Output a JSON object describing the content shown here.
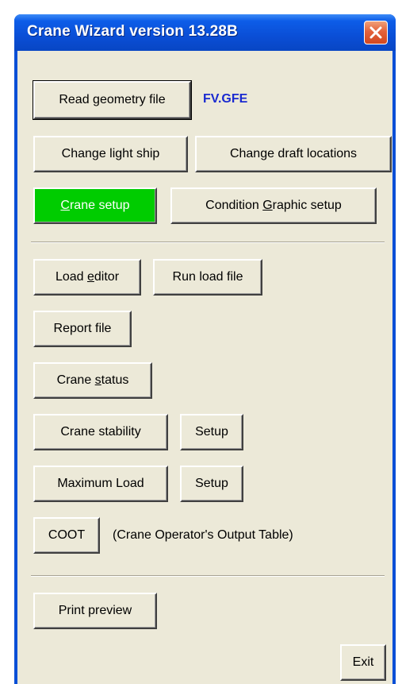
{
  "window": {
    "title": "Crane Wizard version 13.28B"
  },
  "geometry": {
    "read_button": "Read geometry file",
    "filename": "FV.GFE"
  },
  "buttons": {
    "change_light_ship": "Change light ship",
    "change_draft_locations": "Change draft locations",
    "crane_setup": {
      "accel": "C",
      "rest": "rane setup"
    },
    "condition_graphic_setup": {
      "pre": "Condition ",
      "accel": "G",
      "post": "raphic setup"
    },
    "load_editor": {
      "pre": "Load ",
      "accel": "e",
      "post": "ditor"
    },
    "run_load_file": "Run load file",
    "report_file": "Report file",
    "crane_status": {
      "pre": "Crane ",
      "accel": "s",
      "post": "tatus"
    },
    "crane_stability": "Crane stability",
    "crane_stability_setup": "Setup",
    "maximum_load": "Maximum Load",
    "maximum_load_setup": "Setup",
    "coot": "COOT",
    "coot_description": "(Crane Operator's Output Table)",
    "print_preview": "Print preview",
    "exit": "Exit"
  },
  "colors": {
    "crane_setup_active": "#00cc00",
    "filename_text": "#1a2ad0",
    "dialog_background": "#ece9d8",
    "titlebar": "#0a4fd6"
  },
  "icons": {
    "close": "close-x-icon"
  }
}
